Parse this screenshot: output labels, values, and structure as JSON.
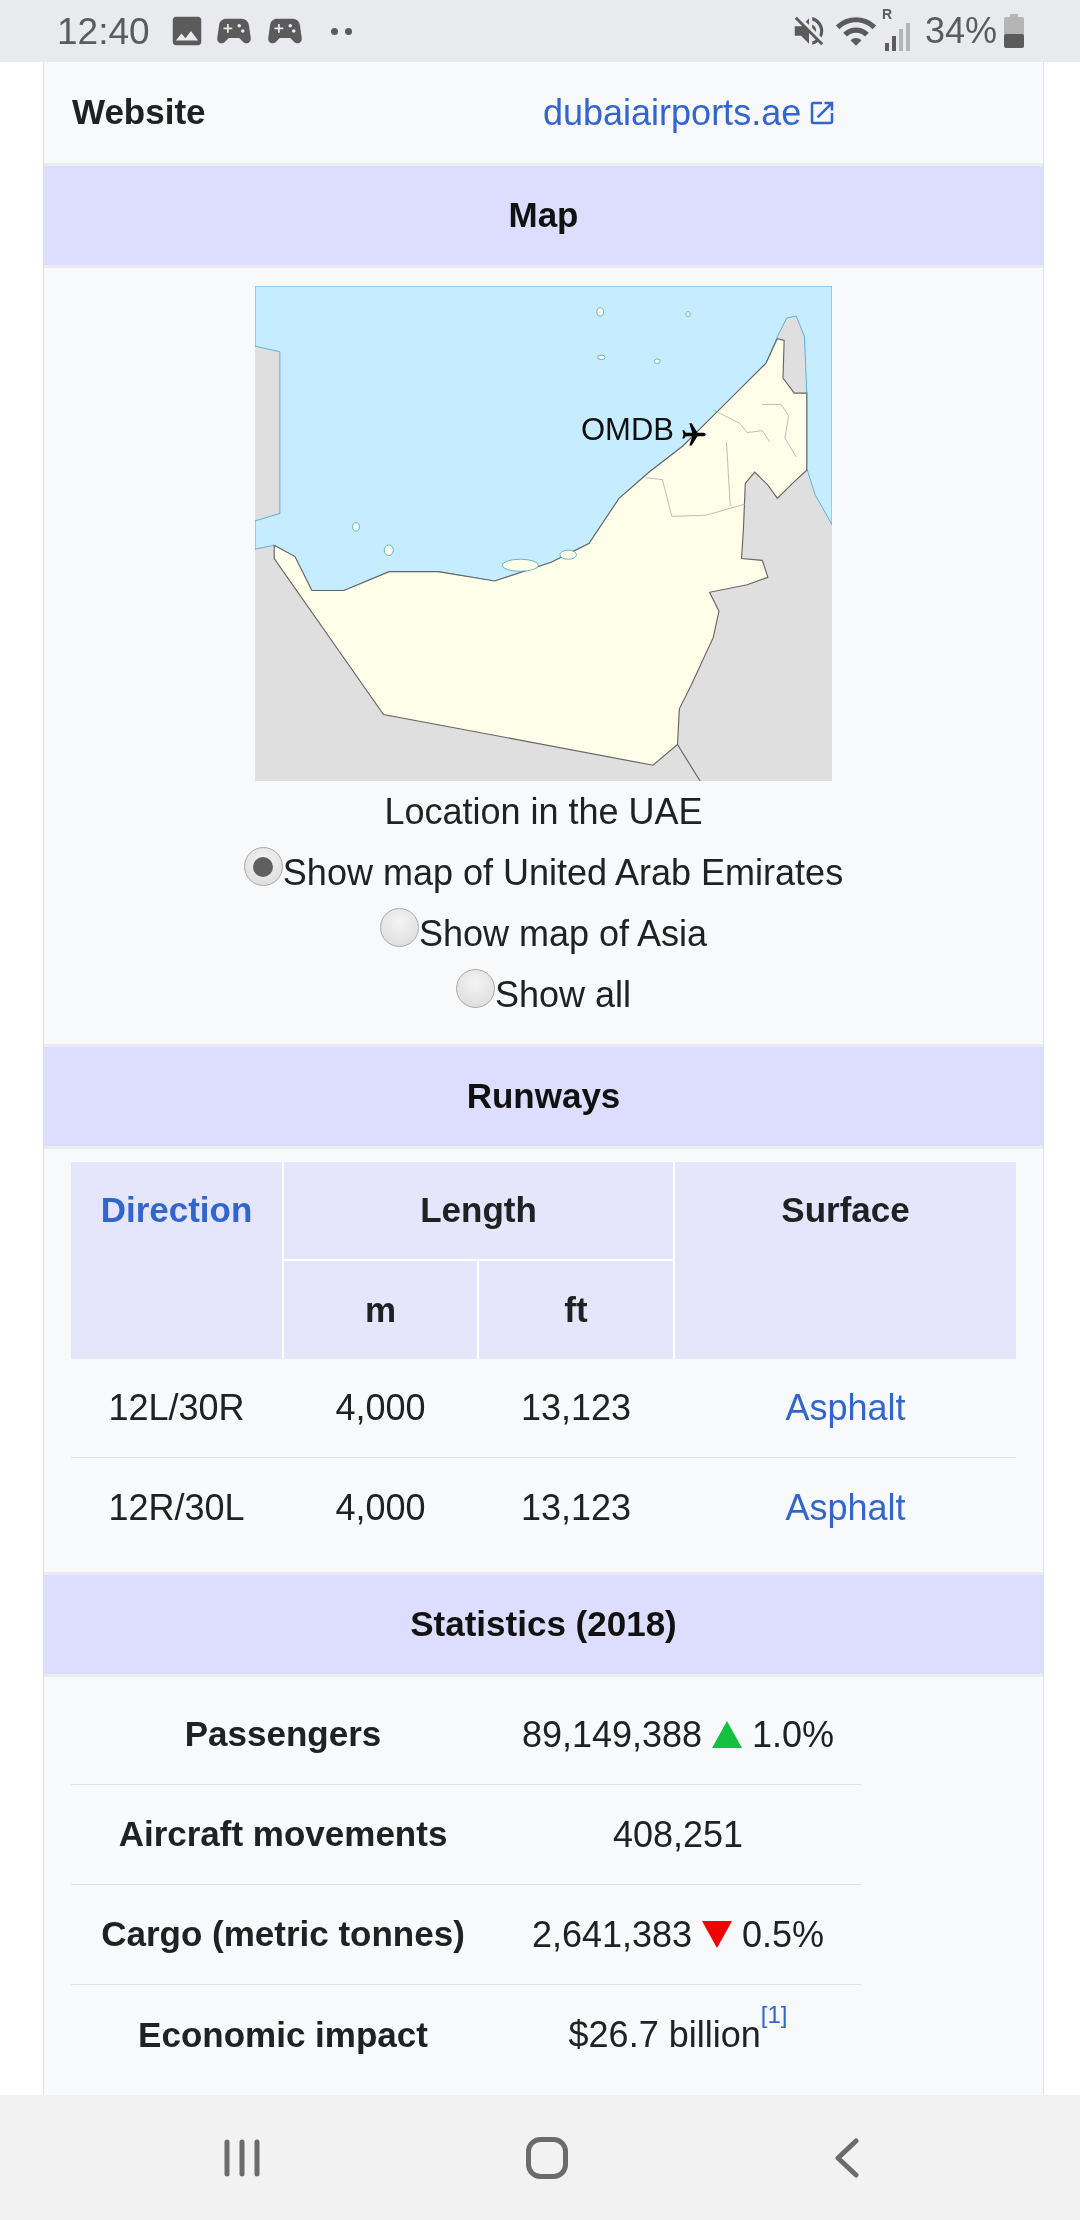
{
  "status_bar": {
    "time": "12:40",
    "signal_label": "R",
    "battery": "34%"
  },
  "infobox": {
    "website": {
      "label": "Website",
      "link": "dubaiairports.ae"
    },
    "map": {
      "heading": "Map",
      "marker_label": "OMDB",
      "caption": "Location in the UAE",
      "options": [
        {
          "label": "Show map of United Arab Emirates",
          "selected": true
        },
        {
          "label": "Show map of Asia",
          "selected": false
        },
        {
          "label": "Show all",
          "selected": false
        }
      ]
    },
    "runways": {
      "heading": "Runways",
      "columns": [
        {
          "label": "Direction",
          "link": true
        },
        {
          "label": "Length",
          "link": false,
          "subcolumns": [
            "m",
            "ft"
          ]
        },
        {
          "label": "Surface",
          "link": false
        }
      ],
      "rows": [
        {
          "direction": "12L/30R",
          "length_m": "4,000",
          "length_ft": "13,123",
          "surface": "Asphalt"
        },
        {
          "direction": "12R/30L",
          "length_m": "4,000",
          "length_ft": "13,123",
          "surface": "Asphalt"
        }
      ]
    },
    "statistics": {
      "heading": "Statistics (2018)",
      "rows": [
        {
          "label": "Passengers",
          "value": "89,149,388",
          "change": {
            "increase": true,
            "text": "1.0%"
          }
        },
        {
          "label": "Aircraft movements",
          "value": "408,251"
        },
        {
          "label": "Cargo (metric tonnes)",
          "value": "2,641,383",
          "change": {
            "increase": false,
            "text": "0.5%"
          }
        },
        {
          "label": "Economic impact",
          "value": "$26.7 billion",
          "reference": "[1]"
        }
      ]
    }
  }
}
